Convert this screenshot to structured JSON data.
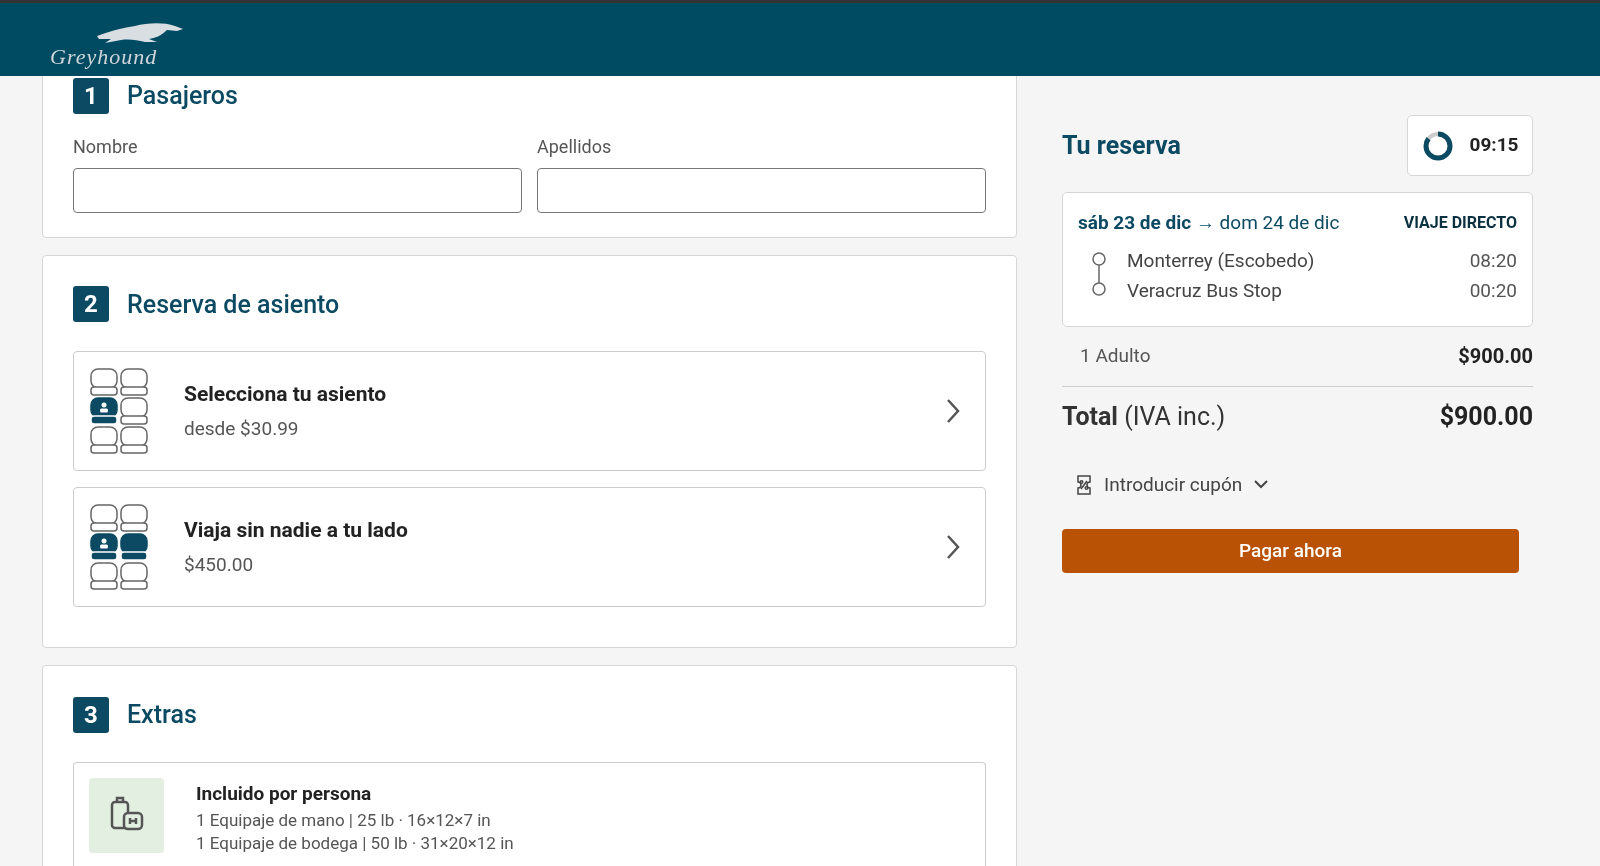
{
  "header": {
    "logo": "Greyhound"
  },
  "sections": [
    {
      "kind": "passengers",
      "number": "1",
      "title": "Pasajeros",
      "fields": [
        {
          "label": "Nombre"
        },
        {
          "label": "Apellidos"
        }
      ]
    },
    {
      "kind": "options",
      "number": "2",
      "title": "Reserva de asiento",
      "options": [
        {
          "kind": "seat",
          "title": "Selecciona tu asiento",
          "subtitle": "desde $30.99"
        },
        {
          "kind": "empty-seat",
          "title": "Viaja sin nadie a tu lado",
          "subtitle": "$450.00"
        }
      ]
    },
    {
      "kind": "extras",
      "number": "3",
      "title": "Extras",
      "items": [
        {
          "title": "Incluido por persona",
          "lines": [
            "1 Equipaje de mano | 25 lb · 16×12×7 in",
            "1 Equipaje de bodega | 50 lb · 31×20×12 in"
          ]
        }
      ]
    }
  ],
  "booking": {
    "title": "Tu reserva",
    "timer": {
      "text": "09:15",
      "level": 0.85
    },
    "trip": {
      "dates": "**sáb 23 de dic** → dom 24 de dic",
      "badge": "VIAJE DIRECTO",
      "stops": [
        {
          "place": "Monterrey (Escobedo)",
          "time": "08:20"
        },
        {
          "place": "Veracruz Bus Stop",
          "time": "00:20"
        }
      ]
    },
    "lines": [
      {
        "label": "1 Adulto",
        "amount": "$900.00"
      }
    ],
    "total": {
      "label": "**Total** (IVA inc.)",
      "amount": "$900.00"
    },
    "coupon": "Introducir cupón",
    "pay_button": "Pagar ahora"
  }
}
